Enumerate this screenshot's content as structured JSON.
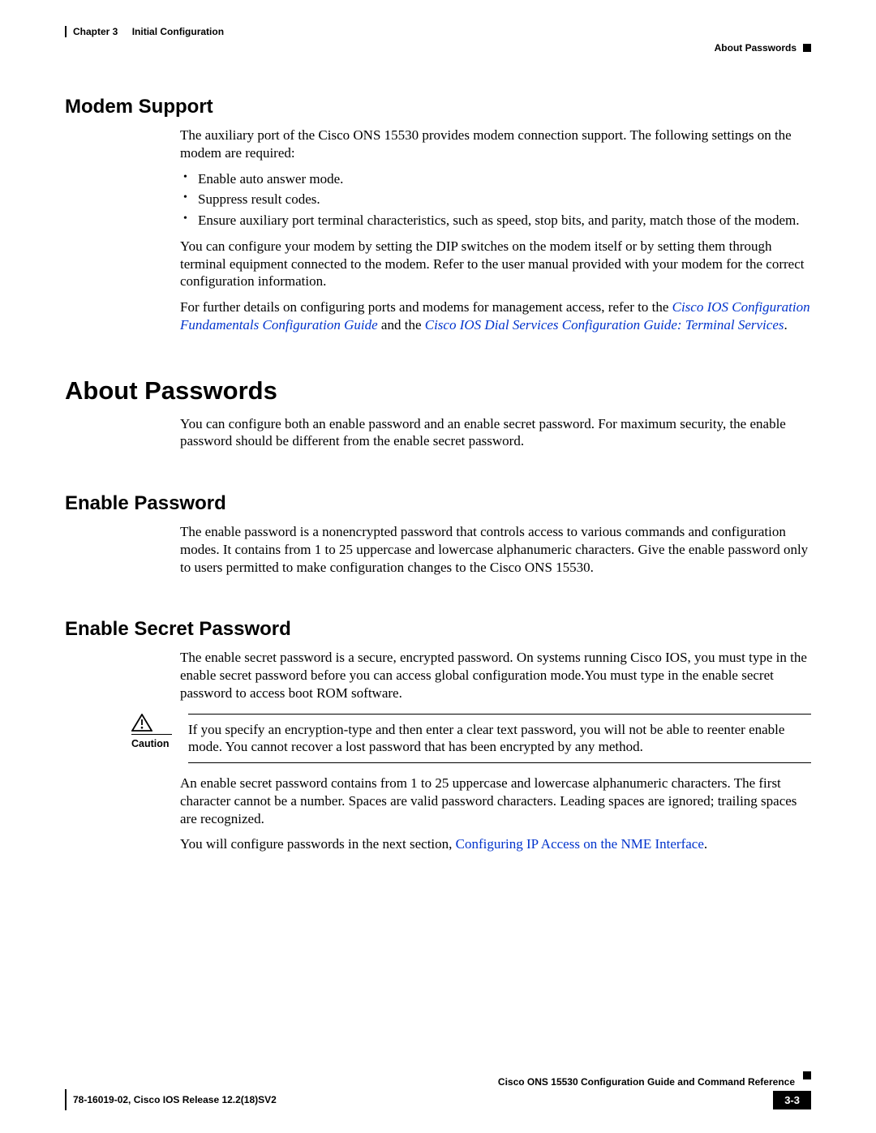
{
  "header": {
    "chapter_label": "Chapter 3",
    "chapter_title": "Initial Configuration",
    "section_marker": "About Passwords"
  },
  "modem_support": {
    "heading": "Modem Support",
    "intro": "The auxiliary port of the Cisco ONS 15530 provides modem connection support. The following settings on the modem are required:",
    "bullets": [
      "Enable auto answer mode.",
      "Suppress result codes.",
      "Ensure auxiliary port terminal characteristics, such as speed, stop bits, and parity, match those of the modem."
    ],
    "para_dip": "You can configure your modem by setting the DIP switches on the modem itself or by setting them through terminal equipment connected to the modem. Refer to the user manual provided with your modem for the correct configuration information.",
    "ref_lead": "For further details on configuring ports and modems for management access, refer to the ",
    "ref_link1": "Cisco IOS Configuration Fundamentals Configuration Guide",
    "ref_mid": " and the ",
    "ref_link2": "Cisco IOS Dial Services Configuration Guide: Terminal Services",
    "ref_tail": "."
  },
  "about_passwords": {
    "heading": "About Passwords",
    "intro": "You can configure both an enable password and an enable secret password. For maximum security, the enable password should be different from the enable secret password."
  },
  "enable_password": {
    "heading": "Enable Password",
    "para": "The enable password is a nonencrypted password that controls access to various commands and configuration modes. It contains from 1 to 25 uppercase and lowercase alphanumeric characters. Give the enable password only to users permitted to make configuration changes to the Cisco ONS 15530."
  },
  "enable_secret": {
    "heading": "Enable Secret Password",
    "para1": "The enable secret password is a secure, encrypted password. On systems running Cisco IOS, you must type in the enable secret password before you can access global configuration mode.You must type in the enable secret password to access boot ROM software.",
    "caution_label": "Caution",
    "caution_text": "If you specify an encryption-type and then enter a clear text password, you will not be able to reenter enable mode. You cannot recover a lost password that has been encrypted by any method.",
    "para2": "An enable secret password contains from 1 to 25 uppercase and lowercase alphanumeric characters. The first character cannot be a number. Spaces are valid password characters. Leading spaces are ignored; trailing spaces are recognized.",
    "para3_lead": "You will configure passwords in the next section, ",
    "para3_link": "Configuring IP Access on the NME Interface",
    "para3_tail": "."
  },
  "footer": {
    "guide_title": "Cisco ONS 15530 Configuration Guide and Command Reference",
    "release_line": "78-16019-02, Cisco IOS Release 12.2(18)SV2",
    "page_number": "3-3"
  }
}
